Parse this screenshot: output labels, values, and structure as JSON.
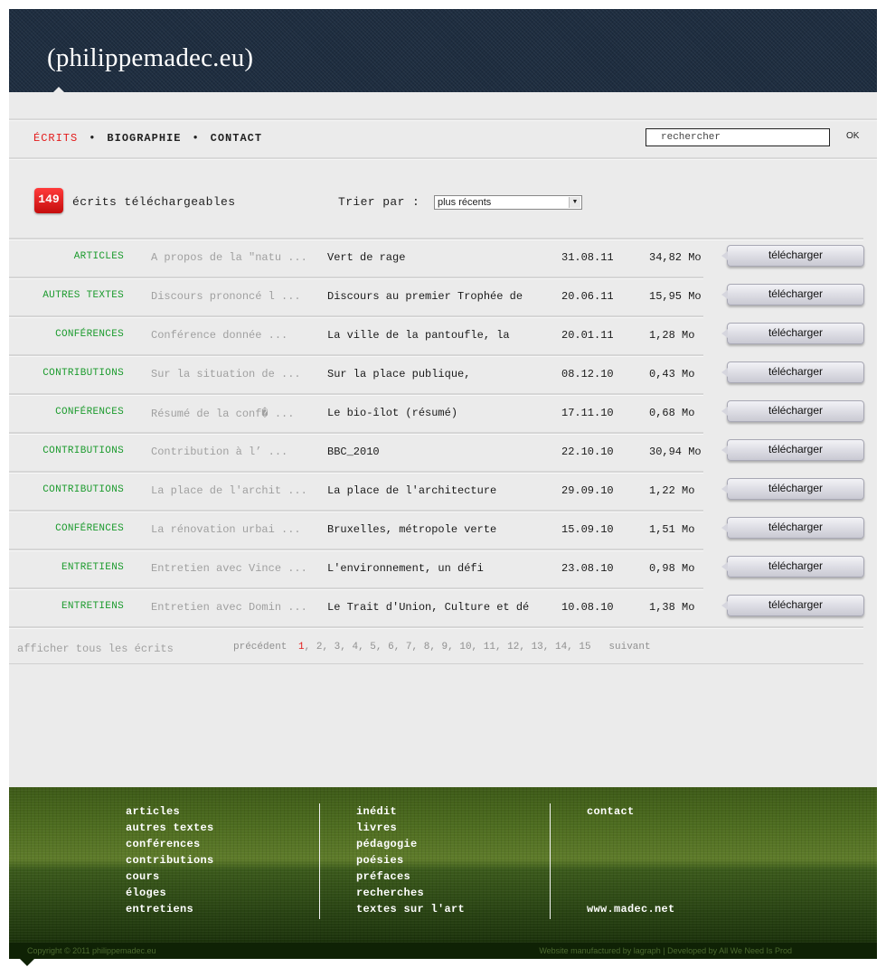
{
  "site": {
    "title": "(philippemadec.eu)"
  },
  "nav": {
    "items": [
      "ÉCRITS",
      "BIOGRAPHIE",
      "CONTACT"
    ]
  },
  "search": {
    "value": "rechercher",
    "ok_label": "OK"
  },
  "listing": {
    "count": "149",
    "count_label": "écrits téléchargeables",
    "sort_label": "Trier par :",
    "sort_value": "plus récents",
    "download_label": "télécharger",
    "rows": [
      {
        "category": "ARTICLES",
        "excerpt": "A propos de la \"natu ...",
        "title": "Vert de rage",
        "date": "31.08.11",
        "size": "34,82 Mo"
      },
      {
        "category": "AUTRES TEXTES",
        "excerpt": "Discours prononcé l ...",
        "title": "Discours au premier Trophée de",
        "date": "20.06.11",
        "size": "15,95 Mo"
      },
      {
        "category": "CONFÉRENCES",
        "excerpt": "Conférence donnée ...",
        "title": "La ville de la pantoufle, la",
        "date": "20.01.11",
        "size": "1,28 Mo"
      },
      {
        "category": "CONTRIBUTIONS",
        "excerpt": "Sur la situation de ...",
        "title": "Sur la place publique,",
        "date": "08.12.10",
        "size": "0,43 Mo"
      },
      {
        "category": "CONFÉRENCES",
        "excerpt": "Résumé de la conf� ...",
        "title": "Le bio-îlot (résumé)",
        "date": "17.11.10",
        "size": "0,68 Mo"
      },
      {
        "category": "CONTRIBUTIONS",
        "excerpt": "Contribution à l’ ...",
        "title": "BBC_2010",
        "date": "22.10.10",
        "size": "30,94 Mo"
      },
      {
        "category": "CONTRIBUTIONS",
        "excerpt": "La place de l'archit ...",
        "title": "La place de l'architecture",
        "date": "29.09.10",
        "size": "1,22 Mo"
      },
      {
        "category": "CONFÉRENCES",
        "excerpt": "La rénovation urbai ...",
        "title": "Bruxelles, métropole verte",
        "date": "15.09.10",
        "size": "1,51 Mo"
      },
      {
        "category": "ENTRETIENS",
        "excerpt": "Entretien avec Vince ...",
        "title": "L'environnement, un défi",
        "date": "23.08.10",
        "size": "0,98 Mo"
      },
      {
        "category": "ENTRETIENS",
        "excerpt": "Entretien avec Domin ...",
        "title": "Le Trait d'Union, Culture et dé",
        "date": "10.08.10",
        "size": "1,38 Mo"
      }
    ]
  },
  "pager": {
    "show_all": "afficher tous les écrits",
    "prev": "précédent",
    "next": "suivant",
    "current": "1",
    "pages": [
      "2",
      "3",
      "4",
      "5",
      "6",
      "7",
      "8",
      "9",
      "10",
      "11",
      "12",
      "13",
      "14",
      "15"
    ]
  },
  "footer": {
    "col1": [
      "articles",
      "autres textes",
      "conférences",
      "contributions",
      "cours",
      "éloges",
      "entretiens"
    ],
    "col2": [
      "inédit",
      "livres",
      "pédagogie",
      "poésies",
      "préfaces",
      "recherches",
      "textes sur l'art"
    ],
    "col3_top": "contact",
    "col3_bottom": "www.madec.net",
    "copyright": "Copyright © 2011 philippemadec.eu",
    "credits": "Website manufactured by lagraph | Developed by All We Need Is Prod"
  },
  "colors": {
    "accent": "#e31b1b",
    "category": "#1c9b2e",
    "header": "#1e2d40"
  }
}
